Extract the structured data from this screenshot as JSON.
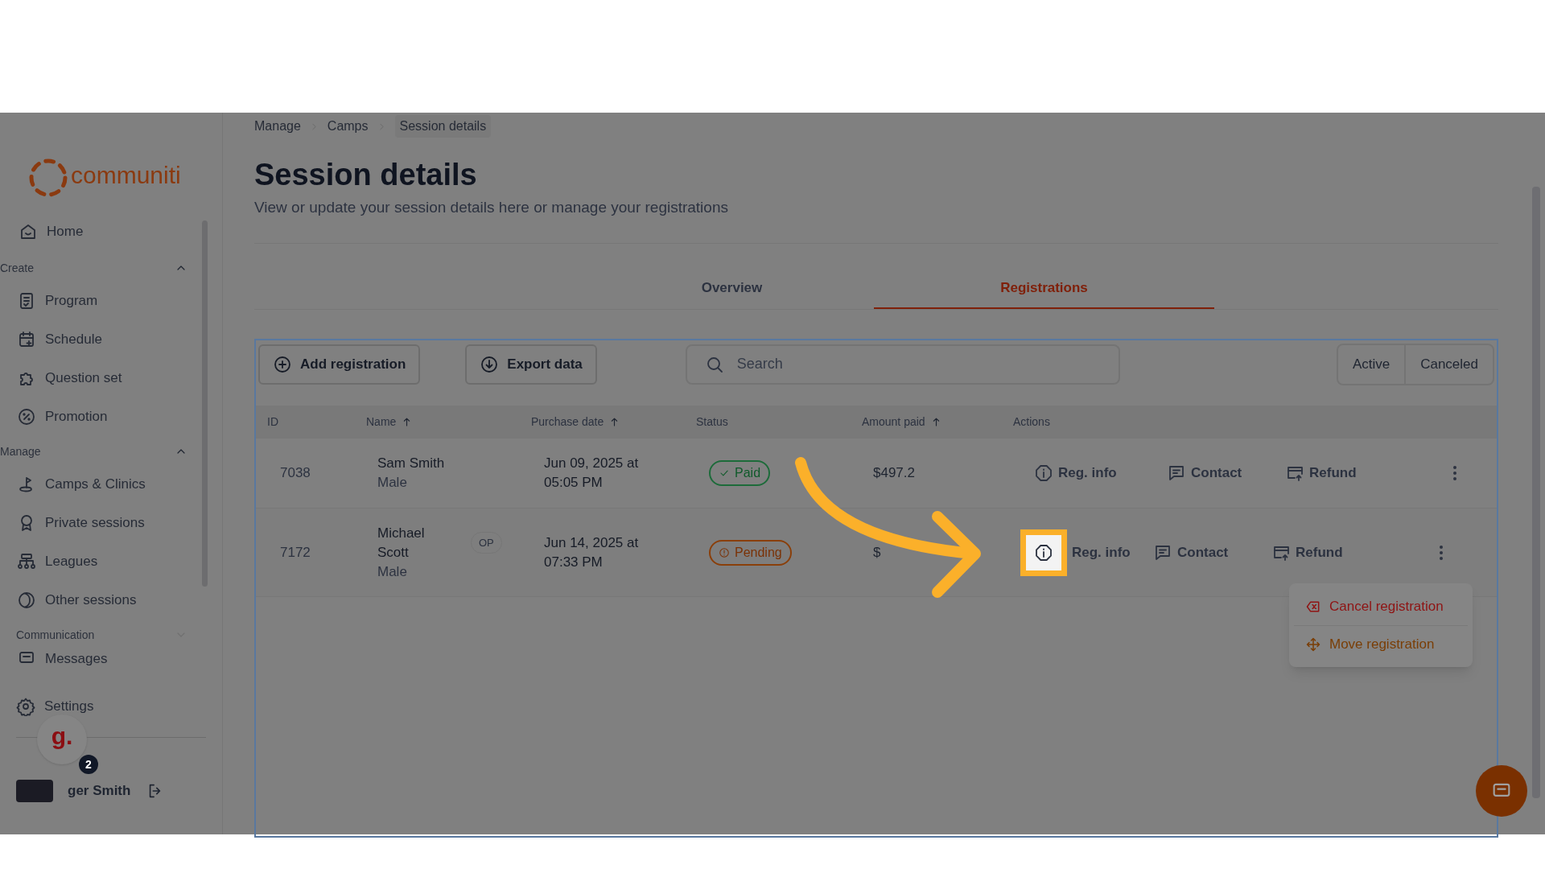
{
  "sidebar": {
    "logo": "communiti",
    "home": {
      "label": "Home"
    },
    "sections": [
      {
        "label": "Create",
        "expanded": true,
        "items": [
          {
            "label": "Program"
          },
          {
            "label": "Schedule"
          },
          {
            "label": "Question set"
          },
          {
            "label": "Promotion"
          }
        ]
      },
      {
        "label": "Manage",
        "expanded": true,
        "items": [
          {
            "label": "Camps & Clinics"
          },
          {
            "label": "Private sessions"
          },
          {
            "label": "Leagues"
          },
          {
            "label": "Other sessions"
          }
        ]
      },
      {
        "label": "Communication",
        "expanded": false,
        "items": [
          {
            "label": "Messages"
          }
        ]
      }
    ],
    "settings": {
      "label": "Settings"
    },
    "helper": {
      "letter": "g.",
      "count": "2"
    },
    "user": {
      "name": "ger Smith"
    }
  },
  "breadcrumb": [
    {
      "label": "Manage",
      "current": false
    },
    {
      "label": "Camps",
      "current": false
    },
    {
      "label": "Session details",
      "current": true
    }
  ],
  "page": {
    "title": "Session details",
    "subtitle": "View or update your session details here or manage your registrations"
  },
  "tabs": [
    {
      "label": "Overview",
      "selected": false
    },
    {
      "label": "Registrations",
      "selected": true
    }
  ],
  "toolbar": {
    "buttons": [
      "Add registration",
      "Export data"
    ],
    "search": {
      "placeholder": "Search"
    },
    "filters": [
      {
        "label": "Active",
        "selected": false
      },
      {
        "label": "Canceled",
        "selected": false
      }
    ]
  },
  "table": {
    "columns": [
      {
        "label": "ID",
        "sortable": false
      },
      {
        "label": "Name",
        "sortable": true
      },
      {
        "label": "Purchase date",
        "sortable": true
      },
      {
        "label": "Status",
        "sortable": false
      },
      {
        "label": "Amount paid",
        "sortable": true
      },
      {
        "label": "Actions",
        "sortable": false
      }
    ],
    "rows": [
      {
        "id": "7038",
        "name": "Sam Smith",
        "gender": "Male",
        "date": "Jun 09, 2025 at 05:05 PM",
        "status": {
          "label": "Paid",
          "kind": "paid"
        },
        "amount": "$497.2",
        "actions": [
          {
            "label": "Reg. info",
            "highlighted": false
          },
          {
            "label": "Contact",
            "highlighted": false
          },
          {
            "label": "Refund",
            "highlighted": false
          }
        ]
      },
      {
        "id": "7172",
        "name": "Michael Scott",
        "gender": "Male",
        "tag": "OP",
        "date": "Jun 14, 2025 at 07:33 PM",
        "status": {
          "label": "Pending",
          "kind": "pending"
        },
        "amount": "$",
        "actions": [
          {
            "label": "Reg. info",
            "highlighted": true
          },
          {
            "label": "Contact",
            "highlighted": false
          },
          {
            "label": "Refund",
            "highlighted": false
          }
        ],
        "menu": [
          {
            "label": "Cancel registration",
            "kind": "danger"
          },
          {
            "label": "Move registration",
            "kind": "move"
          }
        ]
      }
    ]
  }
}
